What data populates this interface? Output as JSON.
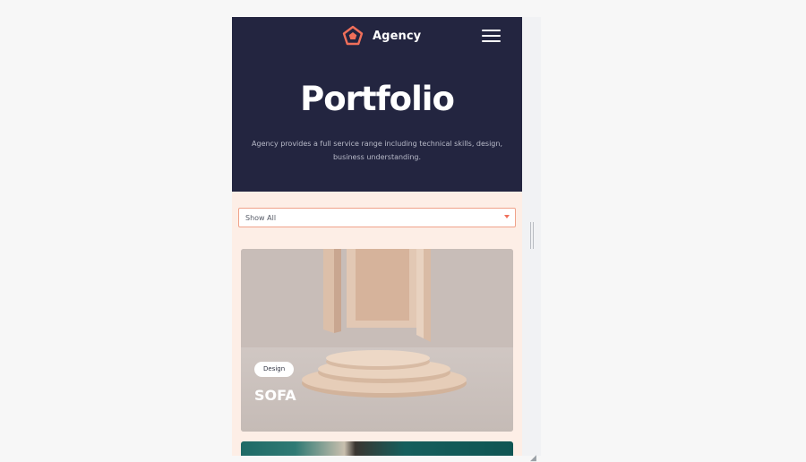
{
  "header": {
    "brand": "Agency",
    "title": "Portfolio",
    "subtitle": "Agency provides a full service range including technical skills, design, business understanding."
  },
  "filter": {
    "selected": "Show All"
  },
  "portfolio": {
    "items": [
      {
        "category": "Design",
        "title": "SOFA"
      }
    ]
  },
  "colors": {
    "header_bg": "#232540",
    "accent": "#f06f5a",
    "page_bg": "#fdeee6"
  },
  "icons": {
    "logo": "pentagon-logo-icon",
    "menu": "hamburger-menu-icon",
    "dropdown": "caret-down-icon"
  }
}
